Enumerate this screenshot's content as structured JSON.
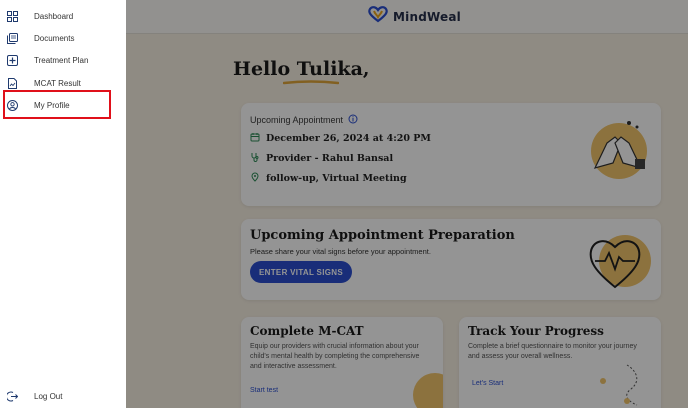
{
  "brand": {
    "name": "MindWeal"
  },
  "greeting": "Hello Tulika,",
  "appointment": {
    "heading": "Upcoming Appointment",
    "date": "December 26, 2024 at 4:20 PM",
    "provider": "Provider - Rahul Bansal",
    "type": "follow-up, Virtual Meeting"
  },
  "preparation": {
    "title": "Upcoming Appointment Preparation",
    "subtitle": "Please share your vital signs before your appointment.",
    "button": "ENTER VITAL SIGNS"
  },
  "mcat": {
    "title": "Complete M-CAT",
    "description": "Equip our providers with crucial information about your child's mental health by completing the comprehensive and interactive assessment.",
    "link": "Start test"
  },
  "track": {
    "title": "Track Your Progress",
    "description": "Complete a brief questionnaire to monitor your journey and assess your overall wellness.",
    "link": "Let's Start"
  },
  "sidebar": {
    "items": [
      {
        "label": "Dashboard",
        "icon": "grid-icon"
      },
      {
        "label": "Documents",
        "icon": "documents-icon"
      },
      {
        "label": "Treatment Plan",
        "icon": "plus-square-icon"
      },
      {
        "label": "MCAT Result",
        "icon": "file-chart-icon"
      },
      {
        "label": "My Profile",
        "icon": "user-circle-icon"
      }
    ],
    "logout": {
      "label": "Log Out",
      "icon": "logout-icon"
    }
  },
  "colors": {
    "accent": "#2b4fd1",
    "highlight": "#e0101a",
    "background": "#f6efe2"
  }
}
